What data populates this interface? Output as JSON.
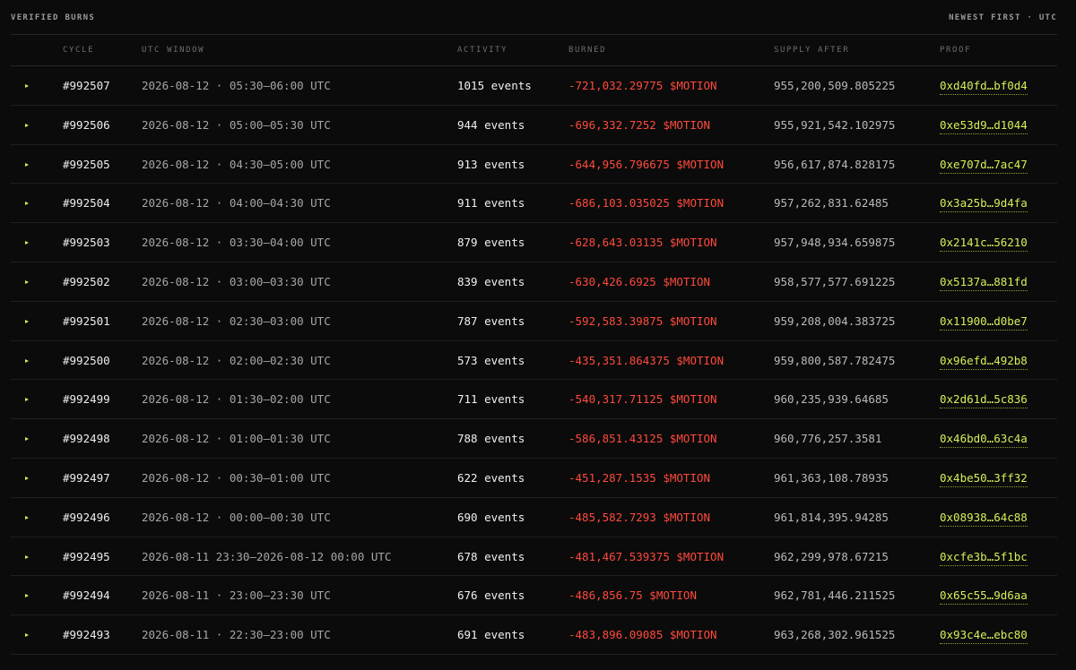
{
  "header": {
    "title": "VERIFIED BURNS",
    "sort_label": "NEWEST FIRST · UTC"
  },
  "columns": [
    "CYCLE",
    "UTC WINDOW",
    "ACTIVITY",
    "BURNED",
    "SUPPLY AFTER",
    "PROOF"
  ],
  "rows": [
    {
      "cycle": "#992507",
      "window": "2026-08-12 · 05:30–06:00 UTC",
      "activity": "1015 events",
      "burned": "-721,032.29775 $MOTION",
      "supply": "955,200,509.805225",
      "proof": "0xd40fd…bf0d4"
    },
    {
      "cycle": "#992506",
      "window": "2026-08-12 · 05:00–05:30 UTC",
      "activity": "944 events",
      "burned": "-696,332.7252 $MOTION",
      "supply": "955,921,542.102975",
      "proof": "0xe53d9…d1044"
    },
    {
      "cycle": "#992505",
      "window": "2026-08-12 · 04:30–05:00 UTC",
      "activity": "913 events",
      "burned": "-644,956.796675 $MOTION",
      "supply": "956,617,874.828175",
      "proof": "0xe707d…7ac47"
    },
    {
      "cycle": "#992504",
      "window": "2026-08-12 · 04:00–04:30 UTC",
      "activity": "911 events",
      "burned": "-686,103.035025 $MOTION",
      "supply": "957,262,831.62485",
      "proof": "0x3a25b…9d4fa"
    },
    {
      "cycle": "#992503",
      "window": "2026-08-12 · 03:30–04:00 UTC",
      "activity": "879 events",
      "burned": "-628,643.03135 $MOTION",
      "supply": "957,948,934.659875",
      "proof": "0x2141c…56210"
    },
    {
      "cycle": "#992502",
      "window": "2026-08-12 · 03:00–03:30 UTC",
      "activity": "839 events",
      "burned": "-630,426.6925 $MOTION",
      "supply": "958,577,577.691225",
      "proof": "0x5137a…881fd"
    },
    {
      "cycle": "#992501",
      "window": "2026-08-12 · 02:30–03:00 UTC",
      "activity": "787 events",
      "burned": "-592,583.39875 $MOTION",
      "supply": "959,208,004.383725",
      "proof": "0x11900…d0be7"
    },
    {
      "cycle": "#992500",
      "window": "2026-08-12 · 02:00–02:30 UTC",
      "activity": "573 events",
      "burned": "-435,351.864375 $MOTION",
      "supply": "959,800,587.782475",
      "proof": "0x96efd…492b8"
    },
    {
      "cycle": "#992499",
      "window": "2026-08-12 · 01:30–02:00 UTC",
      "activity": "711 events",
      "burned": "-540,317.71125 $MOTION",
      "supply": "960,235,939.64685",
      "proof": "0x2d61d…5c836"
    },
    {
      "cycle": "#992498",
      "window": "2026-08-12 · 01:00–01:30 UTC",
      "activity": "788 events",
      "burned": "-586,851.43125 $MOTION",
      "supply": "960,776,257.3581",
      "proof": "0x46bd0…63c4a"
    },
    {
      "cycle": "#992497",
      "window": "2026-08-12 · 00:30–01:00 UTC",
      "activity": "622 events",
      "burned": "-451,287.1535 $MOTION",
      "supply": "961,363,108.78935",
      "proof": "0x4be50…3ff32"
    },
    {
      "cycle": "#992496",
      "window": "2026-08-12 · 00:00–00:30 UTC",
      "activity": "690 events",
      "burned": "-485,582.7293 $MOTION",
      "supply": "961,814,395.94285",
      "proof": "0x08938…64c88"
    },
    {
      "cycle": "#992495",
      "window": "2026-08-11 23:30–2026-08-12 00:00 UTC",
      "activity": "678 events",
      "burned": "-481,467.539375 $MOTION",
      "supply": "962,299,978.67215",
      "proof": "0xcfe3b…5f1bc"
    },
    {
      "cycle": "#992494",
      "window": "2026-08-11 · 23:00–23:30 UTC",
      "activity": "676 events",
      "burned": "-486,856.75 $MOTION",
      "supply": "962,781,446.211525",
      "proof": "0x65c55…9d6aa"
    },
    {
      "cycle": "#992493",
      "window": "2026-08-11 · 22:30–23:00 UTC",
      "activity": "691 events",
      "burned": "-483,896.09085 $MOTION",
      "supply": "963,268,302.961525",
      "proof": "0x93c4e…ebc80"
    }
  ]
}
